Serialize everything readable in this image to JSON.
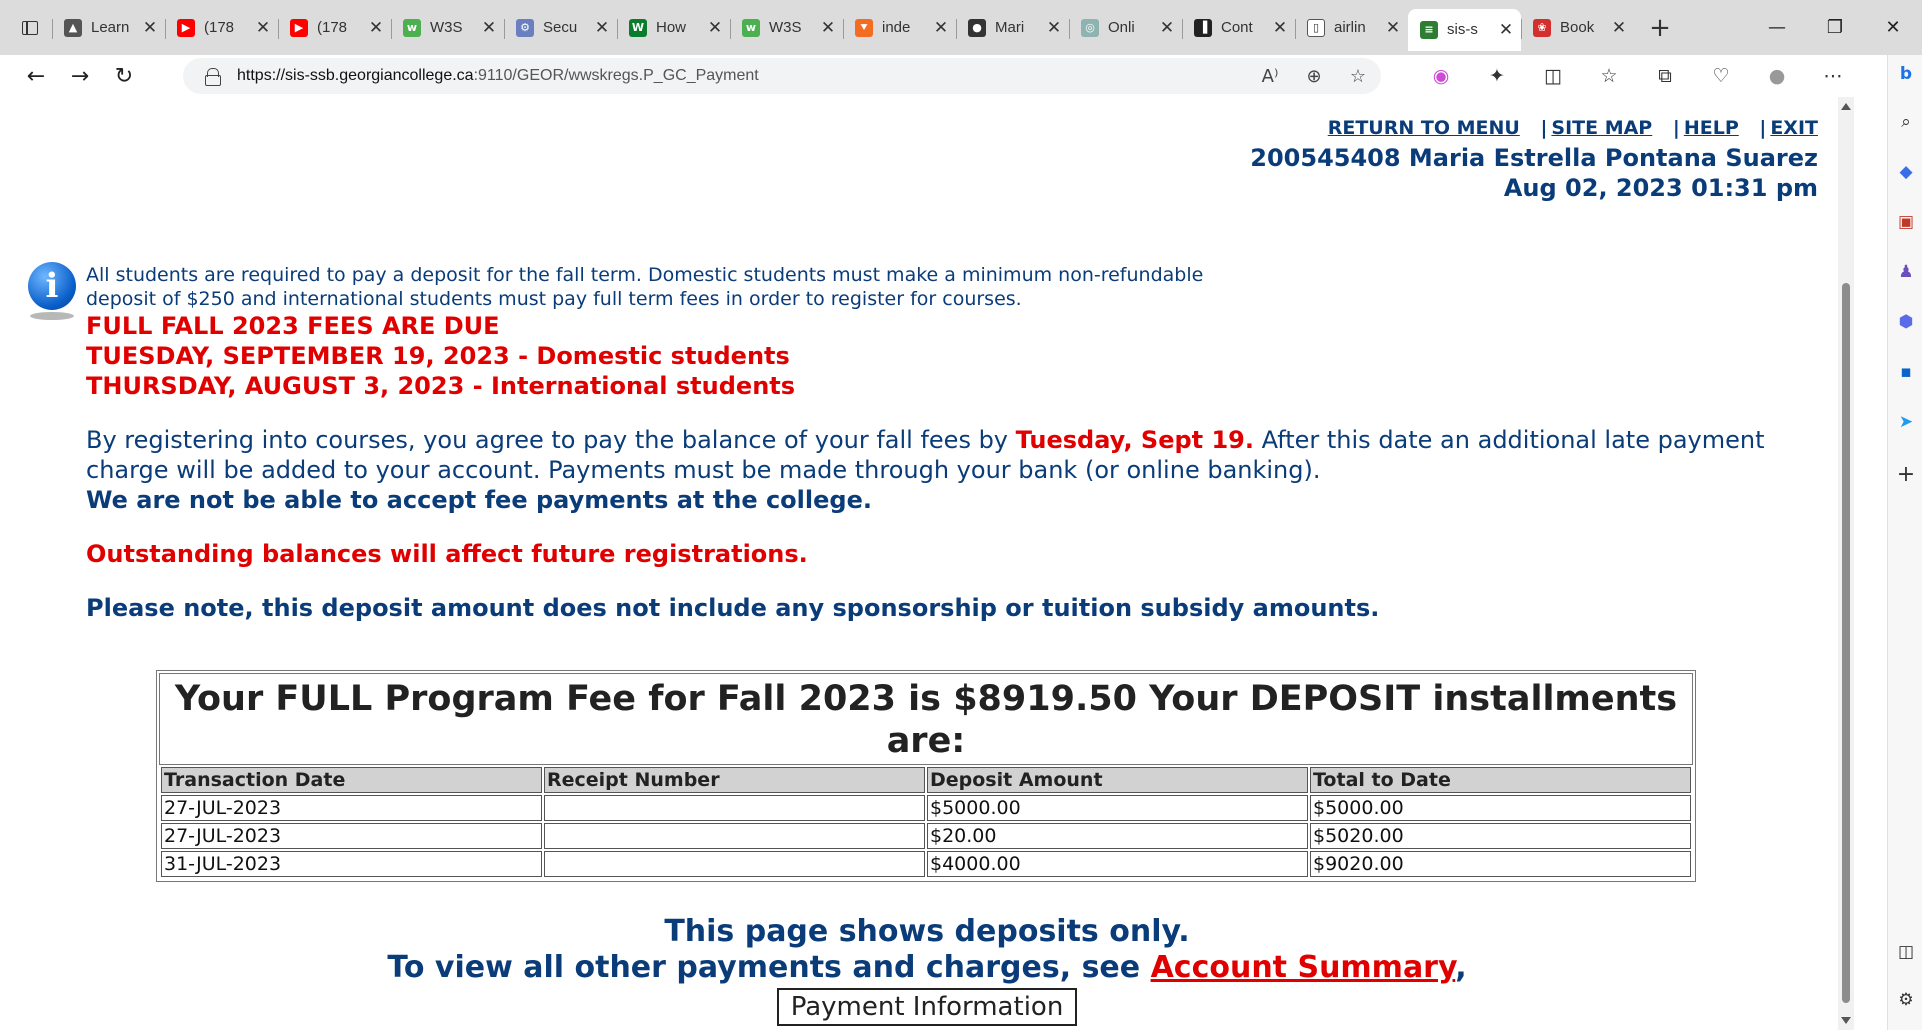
{
  "browser": {
    "tabs": [
      {
        "title": "Learn",
        "fav_color": "#555",
        "fav_glyph": "▲"
      },
      {
        "title": "(178",
        "fav_color": "#ff0000",
        "fav_glyph": "▶"
      },
      {
        "title": "(178",
        "fav_color": "#ff0000",
        "fav_glyph": "▶"
      },
      {
        "title": "W3S",
        "fav_color": "#4caf50",
        "fav_glyph": "w"
      },
      {
        "title": "Secu",
        "fav_color": "#6a7fbf",
        "fav_glyph": "⚙"
      },
      {
        "title": "How",
        "fav_color": "#0a7d2c",
        "fav_glyph": "W"
      },
      {
        "title": "W3S",
        "fav_color": "#4caf50",
        "fav_glyph": "w"
      },
      {
        "title": "inde",
        "fav_color": "#f36c21",
        "fav_glyph": "⯆"
      },
      {
        "title": "Mari",
        "fav_color": "#333",
        "fav_glyph": "●"
      },
      {
        "title": "Onli",
        "fav_color": "#8fb3b0",
        "fav_glyph": "◎"
      },
      {
        "title": "Cont",
        "fav_color": "#222",
        "fav_glyph": "▐"
      },
      {
        "title": "airlin",
        "fav_color": "#ffffff",
        "fav_glyph": "▯"
      },
      {
        "title": "sis-s",
        "fav_color": "#2e7d32",
        "fav_glyph": "≡"
      },
      {
        "title": "Book",
        "fav_color": "#d32f2f",
        "fav_glyph": "❀"
      }
    ],
    "active_tab_index": 12,
    "url_host": "https://sis-ssb.georgiancollege.ca",
    "url_rest": ":9110/GEOR/wwskregs.P_GC_Payment"
  },
  "header": {
    "links": [
      "RETURN TO MENU",
      "SITE MAP",
      "HELP",
      "EXIT"
    ],
    "separator": "|",
    "user": "200545408 Maria Estrella Pontana Suarez",
    "datetime": "Aug 02, 2023 01:31 pm"
  },
  "notice": {
    "line1": "All students are required to pay a deposit for the fall term. Domestic students must make a minimum non-refundable",
    "line2": "deposit of $250 and international students must pay full term fees in order to register for courses.",
    "due1": "FULL FALL 2023 FEES ARE DUE",
    "due2": "TUESDAY, SEPTEMBER 19, 2023 - Domestic students",
    "due3": "THURSDAY, AUGUST 3, 2023 - International students",
    "para_a": "By registering into courses, you agree to pay the balance of your fall fees by ",
    "para_red": "Tuesday, Sept 19.",
    "para_b": " After this date an additional late payment charge will be added to your account. Payments must be made through your bank (or online banking).",
    "no_accept": "We are not be able to accept fee payments at the college.",
    "outstanding": "Outstanding balances will affect future registrations.",
    "please_note": "Please note, this deposit amount does not include any sponsorship or tuition subsidy amounts."
  },
  "fees": {
    "title": "Your FULL Program Fee for Fall 2023 is $8919.50 Your DEPOSIT installments are:",
    "columns": [
      "Transaction Date",
      "Receipt Number",
      "Deposit Amount",
      "Total to Date"
    ],
    "rows": [
      [
        "27-JUL-2023",
        "",
        "$5000.00",
        "$5000.00"
      ],
      [
        "27-JUL-2023",
        "",
        "$20.00",
        "$5020.00"
      ],
      [
        "31-JUL-2023",
        "",
        "$4000.00",
        "$9020.00"
      ]
    ]
  },
  "footer": {
    "line1": "This page shows deposits only.",
    "line2_a": "To view all other payments and charges, see ",
    "line2_link": "Account Summary",
    "line2_b": ",",
    "button": "Payment Information"
  }
}
